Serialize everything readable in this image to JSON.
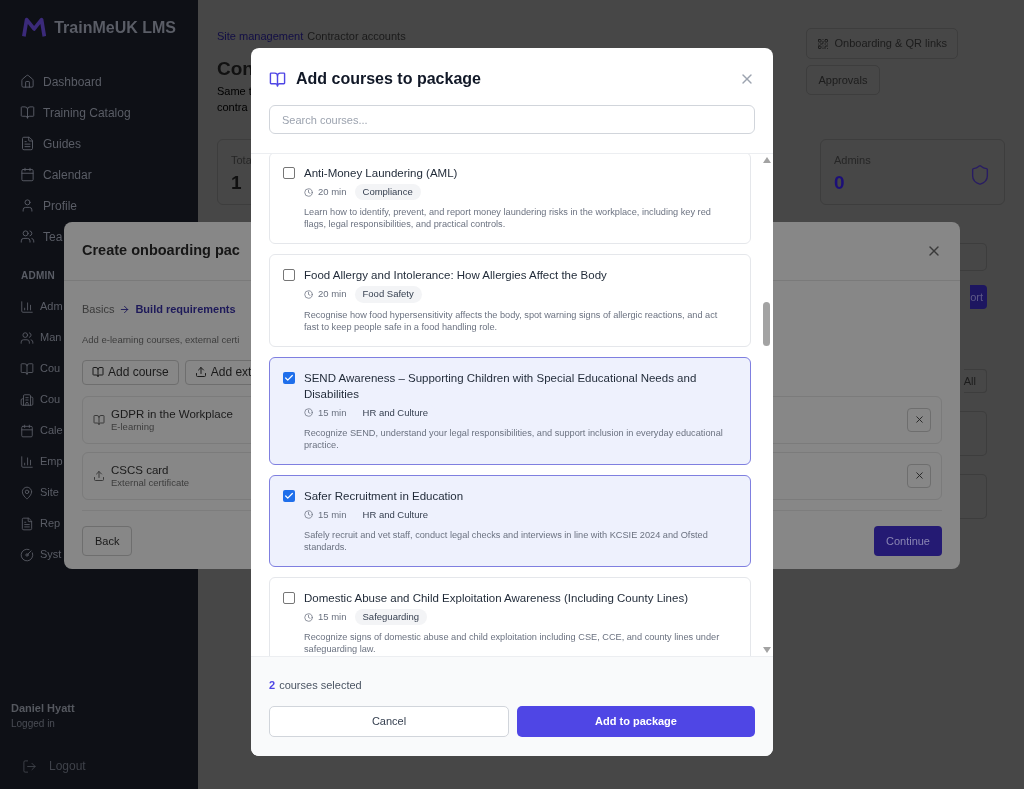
{
  "sidebar": {
    "brand": "TrainMeUK LMS",
    "items": [
      "Dashboard",
      "Training Catalog",
      "Guides",
      "Calendar",
      "Profile",
      "Tea"
    ],
    "section_label": "ADMIN",
    "admin_items": [
      "Adm",
      "Man",
      "Cou",
      "Cou",
      "Cale",
      "Emp",
      "Site",
      "Rep",
      "Syst"
    ],
    "user": {
      "name": "Daniel Hyatt",
      "status": "Logged in"
    },
    "logout": "Logout"
  },
  "page": {
    "breadcrumb": [
      "Site management",
      "Contractor accounts"
    ],
    "title": "Con",
    "subtitle_lines": [
      "Same t",
      "contra"
    ],
    "header_buttons": [
      "Onboarding & QR links",
      "Approvals"
    ],
    "stats": [
      {
        "label": "Tota",
        "value": "1"
      },
      {
        "label": "Admins",
        "value": "0"
      }
    ],
    "import_button": "ort",
    "all_button": "All"
  },
  "onboarding_dialog": {
    "title": "Create onboarding pac",
    "steps": [
      {
        "label": "Basics",
        "selected": false
      },
      {
        "label": "Build requirements",
        "selected": true
      }
    ],
    "hint": "Add e-learning courses, external certi",
    "add_buttons": [
      {
        "label": "Add course",
        "kind": "course"
      },
      {
        "label": "Add ext",
        "kind": "certificate"
      }
    ],
    "requirements": [
      {
        "title": "GDPR in the Workplace",
        "type": "E-learning",
        "kind": "course"
      },
      {
        "title": "CSCS card",
        "type": "External certificate",
        "kind": "certificate"
      }
    ],
    "back": "Back",
    "continue": "Continue"
  },
  "course_dialog": {
    "title": "Add courses to package",
    "search": {
      "placeholder": "Search courses..."
    },
    "courses": [
      {
        "title": "Anti-Money Laundering (AML)",
        "duration": "20 min",
        "category": "Compliance",
        "description": "Learn how to identify, prevent, and report money laundering risks in the workplace, including key red flags, legal responsibilities, and practical controls.",
        "checked": false
      },
      {
        "title": "Food Allergy and Intolerance: How Allergies Affect the Body",
        "duration": "20 min",
        "category": "Food Safety",
        "description": "Recognise how food hypersensitivity affects the body, spot warning signs of allergic reactions, and act fast to keep people safe in a food handling role.",
        "checked": false
      },
      {
        "title": "SEND Awareness – Supporting Children with Special Educational Needs and Disabilities",
        "duration": "15 min",
        "category": "HR and Culture",
        "description": "Recognize SEND, understand your legal responsibilities, and support inclusion in everyday educational practice.",
        "checked": true
      },
      {
        "title": "Safer Recruitment in Education",
        "duration": "15 min",
        "category": "HR and Culture",
        "description": "Safely recruit and vet staff, conduct legal checks and interviews in line with KCSIE 2024 and Ofsted standards.",
        "checked": true
      },
      {
        "title": "Domestic Abuse and Child Exploitation Awareness (Including County Lines)",
        "duration": "15 min",
        "category": "Safeguarding",
        "description": "Recognize signs of domestic abuse and child exploitation including CSE, CCE, and county lines under safeguarding law.",
        "checked": false
      }
    ],
    "selected_count": "2",
    "selected_suffix": "courses selected",
    "cancel": "Cancel",
    "confirm": "Add to package"
  }
}
